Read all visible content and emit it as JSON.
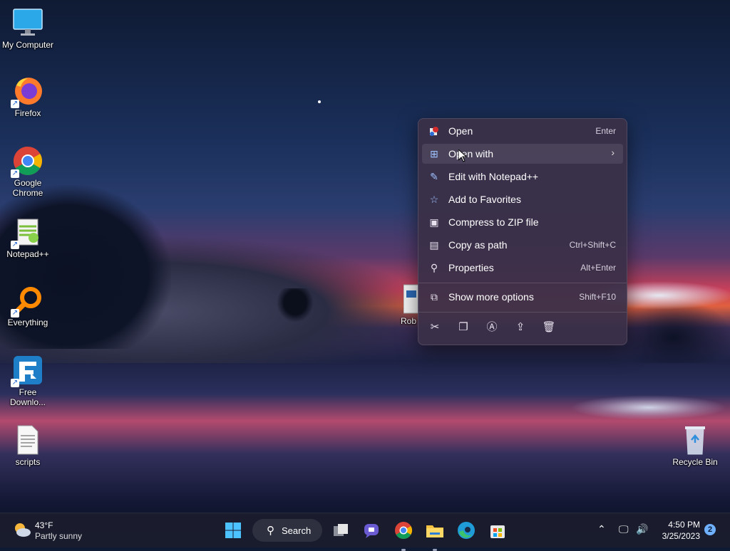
{
  "desktop": {
    "icons": [
      {
        "label": "My Computer"
      },
      {
        "label": "Firefox"
      },
      {
        "label": "Google Chrome"
      },
      {
        "label": "Notepad++"
      },
      {
        "label": "Everything"
      },
      {
        "label": "Free Downlo..."
      },
      {
        "label": "scripts"
      },
      {
        "label": "Recycle Bin"
      }
    ],
    "partial_icon_label": "Rob"
  },
  "context_menu": {
    "items": [
      {
        "label": "Open",
        "shortcut": "Enter",
        "icon": "open-icon"
      },
      {
        "label": "Open with",
        "shortcut": "",
        "icon": "open-with-icon",
        "has_submenu": true
      },
      {
        "label": "Edit with Notepad++",
        "shortcut": "",
        "icon": "notepadpp-icon"
      },
      {
        "label": "Add to Favorites",
        "shortcut": "",
        "icon": "star-icon"
      },
      {
        "label": "Compress to ZIP file",
        "shortcut": "",
        "icon": "zip-icon"
      },
      {
        "label": "Copy as path",
        "shortcut": "Ctrl+Shift+C",
        "icon": "copy-path-icon"
      },
      {
        "label": "Properties",
        "shortcut": "Alt+Enter",
        "icon": "wrench-icon"
      },
      {
        "label": "Show more options",
        "shortcut": "Shift+F10",
        "icon": "more-options-icon"
      }
    ],
    "quick_actions": [
      "cut-icon",
      "copy-icon",
      "rename-icon",
      "share-icon",
      "delete-icon"
    ],
    "hovered_item": "Open with"
  },
  "taskbar": {
    "weather": {
      "temp": "43°F",
      "condition": "Partly sunny"
    },
    "search_label": "Search",
    "apps": [
      "start-icon",
      "task-view-icon",
      "chat-icon",
      "chrome-icon",
      "file-explorer-icon",
      "edge-icon",
      "store-icon"
    ],
    "time": "4:50 PM",
    "date": "3/25/2023",
    "notification_count": "2"
  },
  "colors": {
    "menu_bg": "#3a3048",
    "taskbar_bg": "#1c1e2e",
    "accent": "#6fb0ff"
  }
}
